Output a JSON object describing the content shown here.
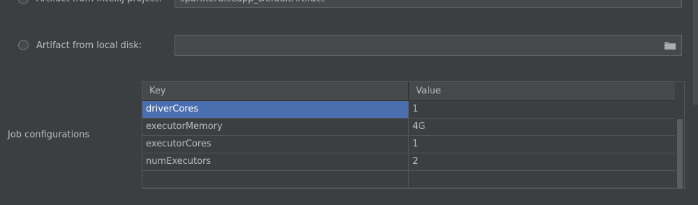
{
  "artifact_intellij": {
    "label": "Artifact from IntelliJ project:",
    "value": "sparkteruiseapp_DefaultArtifact"
  },
  "artifact_disk": {
    "label": "Artifact from local disk:",
    "value": "",
    "browse_icon": "folder-icon"
  },
  "job_config": {
    "label": "Job configurations",
    "columns": {
      "key": "Key",
      "value": "Value"
    },
    "rows": [
      {
        "key": "driverCores",
        "value": "1"
      },
      {
        "key": "executorMemory",
        "value": "4G"
      },
      {
        "key": "executorCores",
        "value": "1"
      },
      {
        "key": "numExecutors",
        "value": "2"
      },
      {
        "key": "",
        "value": ""
      }
    ],
    "selected_row": 0
  },
  "colors": {
    "background": "#3c3f41",
    "selection": "#4b6eaf",
    "text": "#bbbbbb"
  }
}
